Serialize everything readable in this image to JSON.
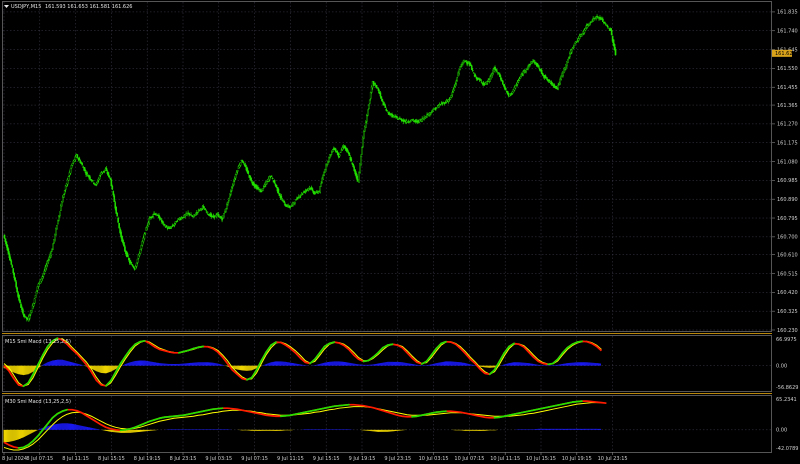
{
  "main": {
    "symbol_title": "USDJPY,M15",
    "ohlc": "161.593 161.653 161.581 161.626",
    "price_ticks": [
      "161.835",
      "161.740",
      "161.645",
      "161.550",
      "161.455",
      "161.365",
      "161.270",
      "161.175",
      "161.080",
      "160.985",
      "160.890",
      "160.795",
      "160.700",
      "160.610",
      "160.515",
      "160.420",
      "160.325",
      "160.230"
    ],
    "current_price": "161.626",
    "current_price_level": 161.626
  },
  "ind1": {
    "title": "M15 Smi Macd (13,25,2,5)",
    "ticks": [
      "66.9975",
      "0.00",
      "-56.8629"
    ]
  },
  "ind2": {
    "title": "M30 Smi Macd (13,25,2,5)",
    "ticks": [
      "65.2341",
      "0.00",
      "-42.0789"
    ]
  },
  "time_labels": [
    "8 Jul 2024",
    "8 Jul 07:15",
    "8 Jul 11:15",
    "8 Jul 15:15",
    "8 Jul 19:15",
    "8 Jul 23:15",
    "9 Jul 03:15",
    "9 Jul 07:15",
    "9 Jul 11:15",
    "9 Jul 15:15",
    "9 Jul 19:15",
    "9 Jul 23:15",
    "10 Jul 03:15",
    "10 Jul 07:15",
    "10 Jul 11:15",
    "10 Jul 15:15",
    "10 Jul 19:15",
    "10 Jul 23:15"
  ],
  "chart_data": [
    {
      "type": "line",
      "title": "USDJPY,M15",
      "ylim": [
        160.23,
        161.88
      ],
      "x_labels": [
        "8 Jul 2024",
        "8 Jul 07:15",
        "8 Jul 11:15",
        "8 Jul 15:15",
        "8 Jul 19:15",
        "8 Jul 23:15",
        "9 Jul 03:15",
        "9 Jul 07:15",
        "9 Jul 11:15",
        "9 Jul 15:15",
        "9 Jul 19:15",
        "9 Jul 23:15",
        "10 Jul 03:15",
        "10 Jul 07:15",
        "10 Jul 11:15",
        "10 Jul 15:15",
        "10 Jul 19:15",
        "10 Jul 23:15"
      ],
      "series": [
        {
          "values": [
            160.71,
            160.62,
            160.52,
            160.4,
            160.31,
            160.28,
            160.35,
            160.45,
            160.5,
            160.57,
            160.64,
            160.76,
            160.88,
            160.97,
            161.06,
            161.11,
            161.07,
            161.02,
            160.99,
            160.96,
            161.02,
            161.04,
            160.99,
            160.85,
            160.72,
            160.63,
            160.57,
            160.54,
            160.62,
            160.71,
            160.79,
            160.82,
            160.8,
            160.76,
            160.74,
            160.76,
            160.79,
            160.8,
            160.82,
            160.8,
            160.83,
            160.85,
            160.82,
            160.8,
            160.81,
            160.79,
            160.86,
            160.95,
            161.03,
            161.09,
            161.04,
            160.98,
            160.95,
            160.93,
            160.97,
            161.01,
            160.96,
            160.9,
            160.86,
            160.85,
            160.88,
            160.91,
            160.93,
            160.95,
            160.92,
            160.93,
            161.03,
            161.1,
            161.15,
            161.11,
            161.16,
            161.12,
            161.05,
            160.98,
            161.2,
            161.34,
            161.48,
            161.45,
            161.38,
            161.33,
            161.31,
            161.3,
            161.29,
            161.28,
            161.29,
            161.28,
            161.29,
            161.31,
            161.33,
            161.35,
            161.37,
            161.38,
            161.4,
            161.47,
            161.56,
            161.59,
            161.57,
            161.51,
            161.49,
            161.47,
            161.49,
            161.55,
            161.52,
            161.46,
            161.41,
            161.44,
            161.49,
            161.53,
            161.56,
            161.59,
            161.56,
            161.52,
            161.49,
            161.47,
            161.45,
            161.52,
            161.58,
            161.65,
            161.69,
            161.72,
            161.76,
            161.79,
            161.81,
            161.8,
            161.77,
            161.74,
            161.62
          ]
        }
      ]
    },
    {
      "type": "line",
      "title": "M15 Smi Macd (13,25,2,5)",
      "ylim": [
        -56.8629,
        66.9975
      ],
      "series": [
        {
          "values": [
            0.0,
            -12.0,
            -30.0,
            -45.0,
            -48.0,
            -40.0,
            -20.0,
            2.0,
            25.0,
            45.0,
            58.0,
            64.0,
            60.0,
            50.0,
            38.0,
            28.0,
            15.0,
            2.0,
            -15.0,
            -34.0,
            -45.0,
            -47.0,
            -35.0,
            -15.0,
            5.0,
            22.0,
            38.0,
            50.0,
            56.0,
            58.0,
            52.0,
            44.0,
            38.0,
            35.0,
            32.0,
            30.0,
            30.0,
            33.0,
            36.0,
            40.0,
            43.0,
            45.0,
            44.0,
            40.0,
            32.0,
            20.0,
            5.0,
            -10.0,
            -20.0,
            -30.0,
            -33.0,
            -28.0,
            -10.0,
            12.0,
            32.0,
            48.0,
            55.0,
            54.0,
            48.0,
            40.0,
            30.0,
            18.0,
            8.0,
            5.0,
            15.0,
            30.0,
            45.0,
            52.0,
            55.0,
            53.0,
            47.0,
            38.0,
            25.0,
            15.0,
            10.0,
            12.0,
            20.0,
            30.0,
            42.0,
            48.0,
            50.0,
            48.0,
            42.0,
            30.0,
            18.0,
            8.0,
            4.0,
            10.0,
            25.0,
            40.0,
            52.0,
            56.0,
            55.0,
            50.0,
            40.0,
            28.0,
            15.0,
            5.0,
            -8.0,
            -18.0,
            -20.0,
            -10.0,
            10.0,
            30.0,
            45.0,
            52.0,
            50.0,
            44.0,
            32.0,
            20.0,
            10.0,
            5.0,
            3.0,
            5.0,
            15.0,
            30.0,
            42.0,
            50.0,
            55.0,
            57.0,
            56.0,
            52.0,
            45.0,
            35.0
          ]
        },
        {
          "values": [
            5.0,
            -5.0,
            -22.0,
            -40.0,
            -48.0,
            -44.0,
            -28.0,
            -5.0,
            18.0,
            38.0,
            53.0,
            62.0,
            63.0,
            55.0,
            43.0,
            32.0,
            20.0,
            8.0,
            -8.0,
            -27.0,
            -42.0,
            -48.0,
            -40.0,
            -22.0,
            -2.0,
            16.0,
            32.0,
            46.0,
            54.0,
            58.0,
            55.0,
            48.0,
            41.0,
            37.0,
            33.0,
            31.0,
            30.0,
            32.0,
            35.0,
            38.0,
            42.0,
            44.0,
            45.0,
            42.0,
            36.0,
            25.0,
            12.0,
            -4.0,
            -16.0,
            -26.0,
            -32.0,
            -31.0,
            -17.0,
            5.0,
            26.0,
            42.0,
            53.0,
            55.0,
            51.0,
            44.0,
            35.0,
            24.0,
            12.0,
            6.0,
            10.0,
            24.0,
            39.0,
            50.0,
            54.0,
            54.0,
            50.0,
            42.0,
            31.0,
            19.0,
            12.0,
            11.0,
            17.0,
            26.0,
            37.0,
            46.0,
            50.0,
            49.0,
            45.0,
            35.0,
            23.0,
            12.0,
            5.0,
            7.0,
            19.0,
            34.0,
            48.0,
            55.0,
            56.0,
            52.0,
            44.0,
            33.0,
            20.0,
            9.0,
            -4.0,
            -14.0,
            -20.0,
            -14.0,
            3.0,
            23.0,
            40.0,
            50.0,
            51.0,
            47.0,
            37.0,
            25.0,
            14.0,
            7.0,
            4.0,
            4.0,
            11.0,
            25.0,
            38.0,
            47.0,
            53.0,
            56.0,
            57.0,
            54.0,
            48.0,
            38.0
          ]
        },
        {
          "values": [
            -5.0,
            -10.0,
            -16.0,
            -20.0,
            -22.0,
            -20.0,
            -14.0,
            -6.0,
            2.0,
            8.0,
            12.0,
            14.0,
            14.0,
            11.0,
            8.0,
            5.0,
            2.0,
            -2.0,
            -7.0,
            -13.0,
            -17.0,
            -18.0,
            -14.0,
            -8.0,
            -2.0,
            4.0,
            8.0,
            11.0,
            12.0,
            12.0,
            10.0,
            8.0,
            6.0,
            5.0,
            4.0,
            4.0,
            4.0,
            5.0,
            6.0,
            7.0,
            8.0,
            8.0,
            8.0,
            7.0,
            5.0,
            2.0,
            -2.0,
            -6.0,
            -9.0,
            -11.0,
            -12.0,
            -11.0,
            -6.0,
            -1.0,
            4.0,
            8.0,
            10.0,
            10.0,
            9.0,
            7.0,
            5.0,
            3.0,
            1.0,
            0.0,
            1.0,
            4.0,
            7.0,
            9.0,
            10.0,
            10.0,
            9.0,
            7.0,
            5.0,
            3.0,
            2.0,
            2.0,
            3.0,
            5.0,
            7.0,
            9.0,
            9.0,
            9.0,
            8.0,
            6.0,
            4.0,
            2.0,
            1.0,
            1.0,
            3.0,
            6.0,
            8.0,
            10.0,
            10.0,
            9.0,
            8.0,
            6.0,
            3.0,
            1.0,
            -2.0,
            -4.0,
            -5.0,
            -4.0,
            -1.0,
            3.0,
            6.0,
            8.0,
            8.0,
            7.0,
            6.0,
            4.0,
            2.0,
            1.0,
            1.0,
            1.0,
            2.0,
            4.0,
            6.0,
            7.0,
            8.0,
            8.0,
            8.0,
            7.0,
            6.0,
            5.0
          ]
        }
      ]
    },
    {
      "type": "line",
      "title": "M30 Smi Macd (13,25,2,5)",
      "ylim": [
        -42.0789,
        65.2341
      ],
      "series": [
        {
          "values": [
            -25.0,
            -30.0,
            -34.0,
            -36.0,
            -35.0,
            -30.0,
            -22.0,
            -12.0,
            0.0,
            12.0,
            24.0,
            32.0,
            37.0,
            40.0,
            40.0,
            38.0,
            34.0,
            28.0,
            22.0,
            16.0,
            10.0,
            5.0,
            2.0,
            0.0,
            -1.0,
            0.0,
            2.0,
            5.0,
            9.0,
            13.0,
            17.0,
            20.0,
            23.0,
            25.0,
            26.0,
            27.0,
            28.0,
            29.0,
            31.0,
            33.0,
            35.0,
            37.0,
            39.0,
            41.0,
            42.0,
            43.0,
            43.0,
            42.0,
            41.0,
            39.0,
            37.0,
            35.0,
            33.0,
            31.0,
            29.0,
            28.0,
            27.0,
            27.0,
            28.0,
            29.0,
            31.0,
            33.0,
            35.0,
            37.0,
            39.0,
            41.0,
            43.0,
            45.0,
            47.0,
            48.0,
            49.0,
            50.0,
            50.0,
            49.0,
            48.0,
            46.0,
            44.0,
            41.0,
            38.0,
            35.0,
            32.0,
            29.0,
            27.0,
            26.0,
            26.0,
            27.0,
            29.0,
            31.0,
            33.0,
            35.0,
            36.0,
            37.0,
            37.0,
            36.0,
            35.0,
            33.0,
            31.0,
            29.0,
            27.0,
            25.0,
            24.0,
            24.0,
            25.0,
            27.0,
            29.0,
            31.0,
            33.0,
            35.0,
            37.0,
            39.0,
            41.0,
            43.0,
            45.0,
            47.0,
            49.0,
            51.0,
            53.0,
            55.0,
            56.0,
            57.0,
            57.0,
            56.0,
            55.0,
            54.0,
            53.0
          ]
        },
        {
          "values": [
            -35.0,
            -38.0,
            -40.0,
            -40.0,
            -38.0,
            -34.0,
            -28.0,
            -20.0,
            -10.0,
            0.0,
            10.0,
            19.0,
            26.0,
            31.0,
            34.0,
            35.0,
            34.0,
            31.0,
            27.0,
            22.0,
            17.0,
            12.0,
            8.0,
            5.0,
            3.0,
            2.0,
            2.0,
            3.0,
            5.0,
            8.0,
            11.0,
            14.0,
            17.0,
            19.0,
            21.0,
            23.0,
            24.0,
            25.0,
            26.0,
            27.0,
            29.0,
            30.0,
            32.0,
            34.0,
            35.0,
            37.0,
            38.0,
            39.0,
            39.0,
            39.0,
            38.0,
            37.0,
            35.0,
            34.0,
            32.0,
            31.0,
            30.0,
            29.0,
            29.0,
            29.0,
            30.0,
            31.0,
            32.0,
            33.0,
            35.0,
            36.0,
            38.0,
            40.0,
            41.0,
            43.0,
            44.0,
            45.0,
            46.0,
            46.0,
            46.0,
            45.0,
            44.0,
            42.0,
            40.0,
            38.0,
            36.0,
            34.0,
            32.0,
            30.0,
            29.0,
            29.0,
            29.0,
            29.0,
            30.0,
            31.0,
            32.0,
            33.0,
            34.0,
            34.0,
            34.0,
            33.0,
            32.0,
            31.0,
            30.0,
            29.0,
            28.0,
            27.0,
            27.0,
            27.0,
            27.0,
            28.0,
            29.0,
            30.0,
            32.0,
            33.0,
            35.0,
            37.0,
            39.0,
            41.0,
            43.0,
            45.0,
            47.0,
            49.0,
            51.0,
            52.0,
            53.0,
            54.0,
            54.0,
            54.0,
            53.0
          ]
        },
        {
          "values": [
            -25.0,
            -24.0,
            -22.0,
            -19.0,
            -15.0,
            -10.0,
            -5.0,
            0.0,
            4.0,
            7.0,
            10.0,
            12.0,
            13.0,
            13.0,
            12.0,
            10.0,
            8.0,
            6.0,
            4.0,
            2.0,
            0.0,
            -2.0,
            -4.0,
            -5.0,
            -6.0,
            -6.0,
            -6.0,
            -5.0,
            -4.0,
            -3.0,
            -2.0,
            -1.0,
            0.0,
            0.0,
            1.0,
            1.0,
            1.0,
            1.0,
            1.0,
            1.0,
            1.0,
            1.0,
            1.0,
            1.0,
            1.0,
            1.0,
            1.0,
            0.0,
            0.0,
            -1.0,
            -1.0,
            -2.0,
            -2.0,
            -2.0,
            -2.0,
            -2.0,
            -2.0,
            -2.0,
            -1.0,
            -1.0,
            0.0,
            0.0,
            1.0,
            1.0,
            1.0,
            1.0,
            1.0,
            1.0,
            1.0,
            1.0,
            1.0,
            1.0,
            0.0,
            0.0,
            -1.0,
            -2.0,
            -3.0,
            -4.0,
            -4.0,
            -4.0,
            -3.0,
            -2.0,
            -1.0,
            0.0,
            0.0,
            0.0,
            0.0,
            0.0,
            0.0,
            0.0,
            0.0,
            0.0,
            0.0,
            -1.0,
            -1.0,
            -2.0,
            -2.0,
            -2.0,
            -2.0,
            -2.0,
            -1.0,
            -1.0,
            0.0,
            0.0,
            0.0,
            0.0,
            1.0,
            1.0,
            1.0,
            1.0,
            2.0,
            2.0,
            2.0,
            2.0,
            2.0,
            2.0,
            2.0,
            2.0,
            2.0,
            2.0,
            2.0,
            2.0,
            2.0,
            2.0
          ]
        }
      ]
    }
  ]
}
